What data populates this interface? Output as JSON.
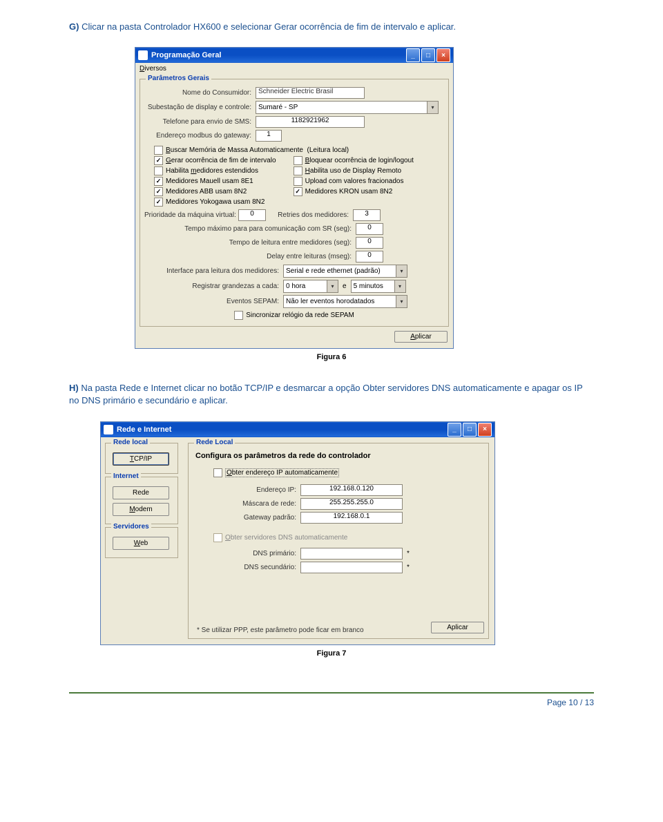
{
  "instr1_prefix": "G)",
  "instr1": "Clicar na pasta Controlador HX600 e selecionar Gerar ocorrência de fim de intervalo e aplicar.",
  "instr2_prefix": "H)",
  "instr2": "Na pasta Rede e Internet clicar no botão TCP/IP e desmarcar a opção Obter servidores DNS automaticamente e apagar os IP no DNS primário e secundário e aplicar.",
  "fig6": "Figura 6",
  "fig7": "Figura 7",
  "page_number": "Page 10 / 13",
  "win1": {
    "title": "Programação Geral",
    "menu": "Diversos",
    "group": "Parâmetros Gerais",
    "f_consumer_lbl": "Nome do Consumidor:",
    "f_consumer_val": "Schneider Electric Brasil",
    "f_subst_lbl": "Subestação de display e controle:",
    "f_subst_val": "Sumaré - SP",
    "f_sms_lbl": "Telefone para envio de SMS:",
    "f_sms_val": "1182921962",
    "f_modbus_lbl": "Endereço modbus do gateway:",
    "f_modbus_val": "1",
    "chk": {
      "c1": "Buscar Memória de Massa Automaticamente  (Leitura local)",
      "c2": "Gerar ocorrência de fim de intervalo",
      "c3": "Bloquear ocorrência de login/logout",
      "c4": "Habilita medidores estendidos",
      "c5": "Habilita uso de Display Remoto",
      "c6": "Medidores Mauell usam 8E1",
      "c7": "Upload com valores fracionados",
      "c8": "Medidores ABB usam 8N2",
      "c9": "Medidores KRON usam 8N2",
      "c10": "Medidores Yokogawa usam 8N2"
    },
    "pri_lbl": "Prioridade da máquina virtual:",
    "pri_val": "0",
    "ret_lbl": "Retries dos medidores:",
    "ret_val": "3",
    "tmax_lbl": "Tempo máximo para para comunicação com SR (seg):",
    "tmax_val": "0",
    "tread_lbl": "Tempo de leitura entre medidores (seg):",
    "tread_val": "0",
    "delay_lbl": "Delay entre leituras (mseg):",
    "delay_val": "0",
    "iface_lbl": "Interface para leitura dos medidores:",
    "iface_val": "Serial e rede ethernet (padrão)",
    "reg_lbl": "Registrar grandezas a cada:",
    "reg_val1": "0 hora",
    "reg_mid": "e",
    "reg_val2": "5 minutos",
    "sepam_lbl": "Eventos SEPAM:",
    "sepam_val": "Não ler eventos horodatados",
    "sync_chk": "Sincronizar relógio da rede SEPAM",
    "apply": "Aplicar"
  },
  "win2": {
    "title": "Rede e Internet",
    "g_local": "Rede local",
    "g_internet": "Internet",
    "g_serv": "Servidores",
    "btn_tcpip": "TCP/IP",
    "btn_rede": "Rede",
    "btn_modem": "Modem",
    "btn_web": "Web",
    "g_main": "Rede Local",
    "heading": "Configura os parâmetros da rede do controlador",
    "chk_auto_ip": "Obter endereço IP automaticamente",
    "ip_lbl": "Endereço IP:",
    "ip_val": "192.168.0.120",
    "mask_lbl": "Máscara de rede:",
    "mask_val": "255.255.255.0",
    "gw_lbl": "Gateway padrão:",
    "gw_val": "192.168.0.1",
    "chk_auto_dns": "Obter servidores DNS automaticamente",
    "dns1_lbl": "DNS primário:",
    "dns2_lbl": "DNS secundário:",
    "dns_star": "*",
    "hint": "*  Se utilizar PPP, este parâmetro pode ficar em branco",
    "apply": "Aplicar"
  }
}
